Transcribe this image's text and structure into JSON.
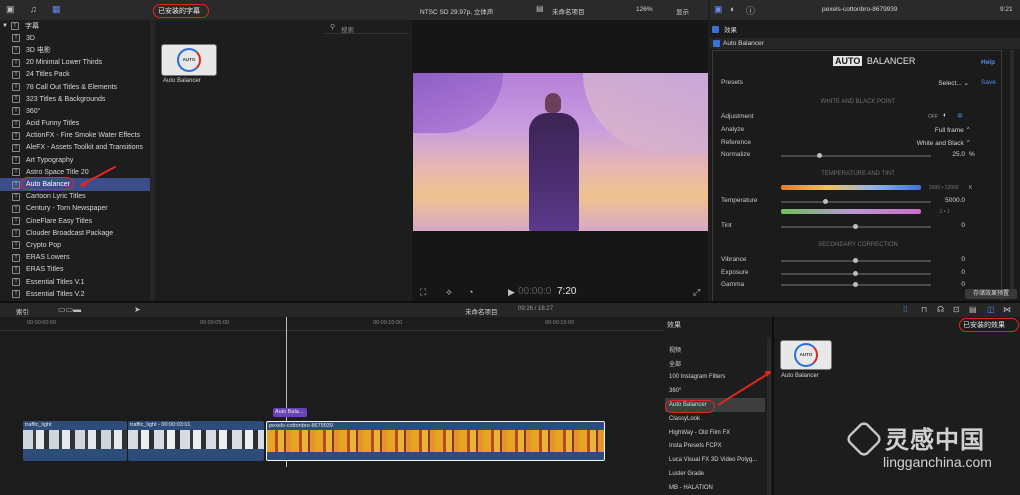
{
  "libraries": {
    "root_label": "字幕",
    "selected_filter_label": "已安装的字幕"
  },
  "sidebar": {
    "items": [
      {
        "label": "3D"
      },
      {
        "label": "3D 电影"
      },
      {
        "label": "20 Minimal Lower Thirds"
      },
      {
        "label": "24 Titles Pack"
      },
      {
        "label": "78 Call Out Titles & Elements"
      },
      {
        "label": "323 Titles & Backgrounds"
      },
      {
        "label": "360°"
      },
      {
        "label": "Acid Funny Titles"
      },
      {
        "label": "ActionFX - Fire Smoke Water Effects"
      },
      {
        "label": "AleFX - Assets Toolkit and Transitions"
      },
      {
        "label": "Art Typography"
      },
      {
        "label": "Astro Space Title 20"
      },
      {
        "label": "Auto Balancer"
      },
      {
        "label": "Cartoon Lyric Titles"
      },
      {
        "label": "Century - Torn Newspaper"
      },
      {
        "label": "CineFlare Easy Titles"
      },
      {
        "label": "Clouder Broadcast Package"
      },
      {
        "label": "Crypto Pop"
      },
      {
        "label": "ERAS Lowers"
      },
      {
        "label": "ERAS Titles"
      },
      {
        "label": "Essential Titles V.1"
      },
      {
        "label": "Essential Titles V.2"
      }
    ],
    "selected_index": 12
  },
  "browser": {
    "search_placeholder": "搜索",
    "thumb_label": "Auto Balancer",
    "thumb_badge": "AUTO"
  },
  "viewer": {
    "format": "NTSC SD 29.97p, 立体声",
    "project": "未命名项目",
    "zoom": "126%",
    "view_menu": "显示",
    "timecode_dim": "00:00:0",
    "timecode_bright": "7:20"
  },
  "inspector": {
    "clip_name": "pexels-cottonbro-8679939",
    "time": "9:21",
    "section_label": "效果",
    "effect_name": "Auto Balancer",
    "logo_auto": "AUTO",
    "logo_balancer": "BALANCER",
    "help": "Help",
    "presets_label": "Presets",
    "presets_select": "Select... ⌄",
    "save": "Save",
    "white_black_head": "WHITE AND BLACK POINT",
    "adjustment_label": "Adjustment",
    "adjustment_off": "OFF",
    "analyze_label": "Analyze",
    "analyze_value": "Full frame ⌃",
    "reference_label": "Reference",
    "reference_value": "White and Black ⌃",
    "normalize_label": "Normalize",
    "normalize_value": "25.0",
    "normalize_unit": "%",
    "temp_tint_head": "TEMPERATURE AND TINT",
    "temp_scale": "2000 • 12000",
    "temp_unit": "K",
    "temperature_label": "Temperature",
    "temperature_value": "5000.0",
    "tint_scale": "-1 • 1",
    "tint_label": "Tint",
    "tint_value": "0",
    "secondary_head": "SECONDARY CORRECTION",
    "vibrance_label": "Vibrance",
    "vibrance_value": "0",
    "exposure_label": "Exposure",
    "exposure_value": "0",
    "gamma_label": "Gamma",
    "gamma_value": "0",
    "save_preset": "存储效果预置"
  },
  "timeline": {
    "index_label": "索引",
    "project": "未命名项目",
    "duration": "09:26 / 16:27",
    "ruler": [
      "00:00:00:00",
      "00:00:05:00",
      "00:00:10:00",
      "00:00:15:00"
    ],
    "effect_clip": "Auto Bala...",
    "clips": [
      {
        "label": "traffic_light"
      },
      {
        "label": "traffic_light - 00:00:03:01"
      },
      {
        "label": "pexels-cottonbro-8679939"
      }
    ]
  },
  "effects": {
    "title": "效果",
    "installed_label": "已安装的效果",
    "category_head": "视频",
    "items": [
      {
        "label": "全部"
      },
      {
        "label": "100 Instagram Filters"
      },
      {
        "label": "360°"
      },
      {
        "label": "Auto Balancer"
      },
      {
        "label": "ClassyLook"
      },
      {
        "label": "HighWay - Old Film FX"
      },
      {
        "label": "Insta Presets FCPX"
      },
      {
        "label": "Luca Visual FX 3D Video Polyg..."
      },
      {
        "label": "Luster Grade"
      },
      {
        "label": "MB - HALATION"
      }
    ],
    "selected_index": 3,
    "thumb_label": "Auto Balancer",
    "thumb_badge": "AUTO"
  },
  "watermark": {
    "cn": "灵感中国",
    "url": "lingganchina.com"
  },
  "colors": {
    "accent_red": "#e0271f",
    "selection_blue": "#3c4e8a",
    "clip_blue": "#2d4c7a",
    "clip_gold": "#d9951d"
  }
}
